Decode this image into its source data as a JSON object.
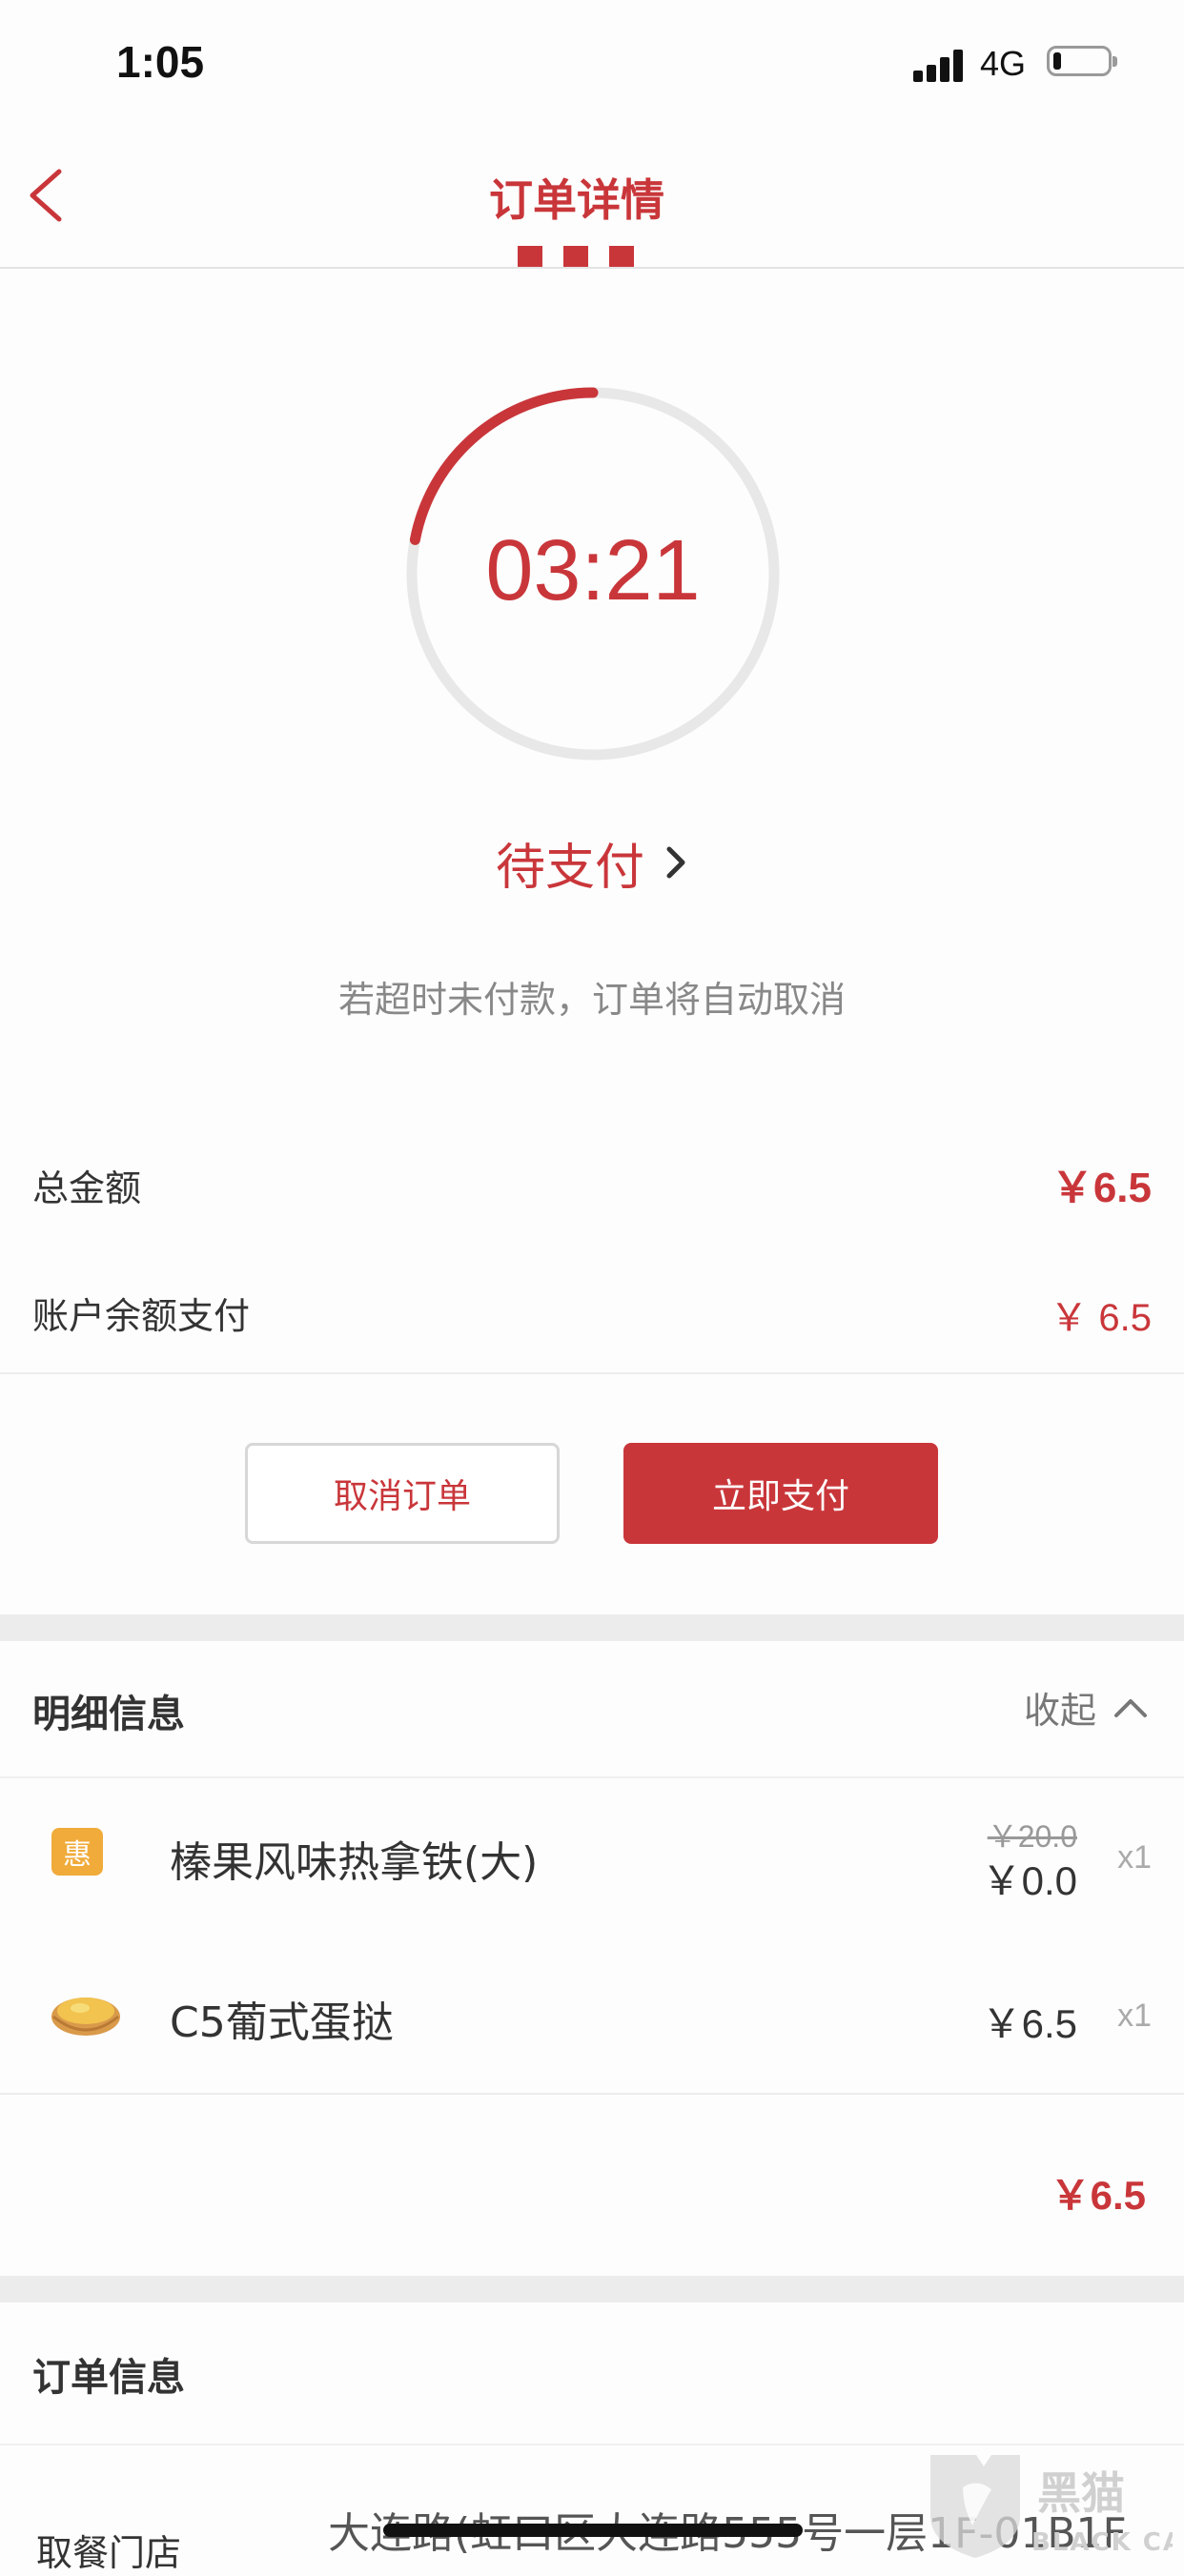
{
  "status_bar": {
    "time": "1:05",
    "network": "4G",
    "battery_level": 0.12
  },
  "nav": {
    "title": "订单详情",
    "back_icon": "chevron-left-icon"
  },
  "countdown": {
    "time": "03:21",
    "progress": 0.22,
    "ring_color": "#c9363a",
    "track_color": "#e8e8e8"
  },
  "status": {
    "text": "待支付",
    "icon": "chevron-right-icon"
  },
  "timeout_note": "若超时未付款，订单将自动取消",
  "totals": {
    "total_label": "总金额",
    "total_value": "￥6.5",
    "balance_label": "账户余额支付",
    "balance_value": "￥ 6.5"
  },
  "actions": {
    "cancel_label": "取消订单",
    "pay_label": "立即支付"
  },
  "details": {
    "title": "明细信息",
    "collapse_label": "收起",
    "items": [
      {
        "badge": "惠",
        "name": "榛果风味热拿铁(大)",
        "original_price": "￥20.0",
        "price": "￥0.0",
        "qty": "x1"
      },
      {
        "name": "C5葡式蛋挞",
        "price": "￥6.5",
        "qty": "x1",
        "icon": "egg-tart-icon"
      }
    ],
    "subtotal": "￥6.5"
  },
  "order_info": {
    "title": "订单信息",
    "store_label": "取餐门店",
    "store_address": "大连路(虹口区大连路555号一层1F-01B1F"
  },
  "colors": {
    "accent": "#c9363a",
    "badge": "#f0ab3b"
  }
}
